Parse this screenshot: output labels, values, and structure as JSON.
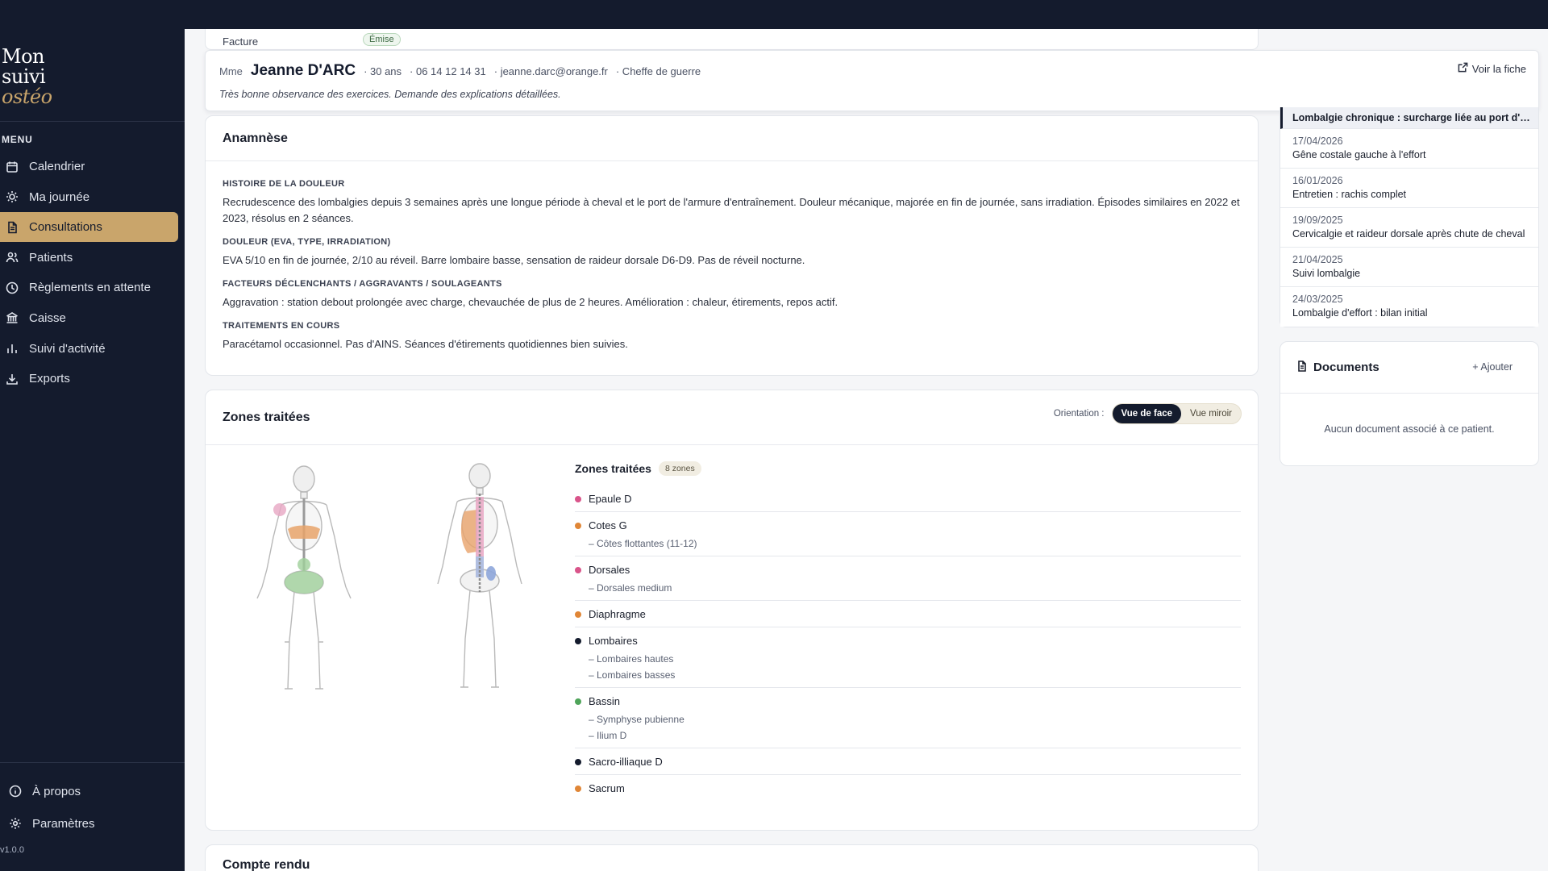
{
  "brand": {
    "line1": "Mon",
    "line2": "suivi",
    "line3": "ostéo"
  },
  "sidebar": {
    "menu_title": "MENU",
    "items": [
      {
        "label": "Calendrier",
        "icon": "calendar-icon",
        "active": false
      },
      {
        "label": "Ma journée",
        "icon": "sun-icon",
        "active": false
      },
      {
        "label": "Consultations",
        "icon": "document-icon",
        "active": true
      },
      {
        "label": "Patients",
        "icon": "users-icon",
        "active": false
      },
      {
        "label": "Règlements en attente",
        "icon": "clock-icon",
        "active": false
      },
      {
        "label": "Caisse",
        "icon": "bank-icon",
        "active": false
      },
      {
        "label": "Suivi d'activité",
        "icon": "bar-chart-icon",
        "active": false
      },
      {
        "label": "Exports",
        "icon": "download-icon",
        "active": false
      }
    ],
    "bottom": [
      {
        "label": "À propos",
        "icon": "info-icon"
      },
      {
        "label": "Paramètres",
        "icon": "gear-icon"
      }
    ],
    "version": "v1.0.0"
  },
  "invoice": {
    "label": "Facture",
    "status": "Émise"
  },
  "patient": {
    "civility": "Mme",
    "name": "Jeanne D'ARC",
    "age": "· 30 ans",
    "phone": "· 06 14 12 14 31",
    "email": "· jeanne.darc@orange.fr",
    "profession": "· Cheffe de guerre",
    "note": "Très bonne observance des exercices. Demande des explications détaillées.",
    "view_link": "Voir la fiche"
  },
  "anamnese": {
    "title": "Anamnèse",
    "sections": [
      {
        "title": "HISTOIRE DE LA DOULEUR",
        "text": "Recrudescence des lombalgies depuis 3 semaines après une longue période à cheval et le port de l'armure d'entraînement. Douleur mécanique, majorée en fin de journée, sans irradiation. Épisodes similaires en 2022 et 2023, résolus en 2 séances."
      },
      {
        "title": "DOULEUR (EVA, TYPE, IRRADIATION)",
        "text": "EVA 5/10 en fin de journée, 2/10 au réveil. Barre lombaire basse, sensation de raideur dorsale D6-D9. Pas de réveil nocturne."
      },
      {
        "title": "FACTEURS DÉCLENCHANTS / AGGRAVANTS / SOULAGEANTS",
        "text": "Aggravation : station debout prolongée avec charge, chevauchée de plus de 2 heures. Amélioration : chaleur, étirements, repos actif."
      },
      {
        "title": "TRAITEMENTS EN COURS",
        "text": "Paracétamol occasionnel. Pas d'AINS. Séances d'étirements quotidiennes bien suivies."
      }
    ]
  },
  "zones": {
    "title": "Zones traitées",
    "orientation_label": "Orientation :",
    "orientation_options": [
      "Vue de face",
      "Vue miroir"
    ],
    "list_title": "Zones traitées",
    "count_badge": "8 zones",
    "items": [
      {
        "name": "Epaule D",
        "color": "#d9548a",
        "subs": []
      },
      {
        "name": "Cotes G",
        "color": "#e08637",
        "subs": [
          "– Côtes flottantes (11-12)"
        ]
      },
      {
        "name": "Dorsales",
        "color": "#d9548a",
        "subs": [
          "– Dorsales medium"
        ]
      },
      {
        "name": "Diaphragme",
        "color": "#e08637",
        "subs": []
      },
      {
        "name": "Lombaires",
        "color": "#141b2d",
        "subs": [
          "– Lombaires hautes",
          "– Lombaires basses"
        ]
      },
      {
        "name": "Bassin",
        "color": "#4fa45a",
        "subs": [
          "– Symphyse pubienne",
          "– Ilium D"
        ]
      },
      {
        "name": "Sacro-illiaque D",
        "color": "#141b2d",
        "subs": []
      },
      {
        "name": "Sacrum",
        "color": "#e08637",
        "subs": []
      }
    ]
  },
  "compte_rendu": {
    "title": "Compte rendu"
  },
  "history": [
    {
      "date": "",
      "title": "Lombalgie chronique : surcharge liée au port d'armure",
      "active": true
    },
    {
      "date": "17/04/2026",
      "title": "Gêne costale gauche à l'effort",
      "active": false
    },
    {
      "date": "16/01/2026",
      "title": "Entretien : rachis complet",
      "active": false
    },
    {
      "date": "19/09/2025",
      "title": "Cervicalgie et raideur dorsale après chute de cheval",
      "active": false
    },
    {
      "date": "21/04/2025",
      "title": "Suivi lombalgie",
      "active": false
    },
    {
      "date": "24/03/2025",
      "title": "Lombalgie d'effort : bilan initial",
      "active": false
    }
  ],
  "documents": {
    "title": "Documents",
    "add_label": "+ Ajouter",
    "empty_text": "Aucun document associé à ce patient."
  }
}
